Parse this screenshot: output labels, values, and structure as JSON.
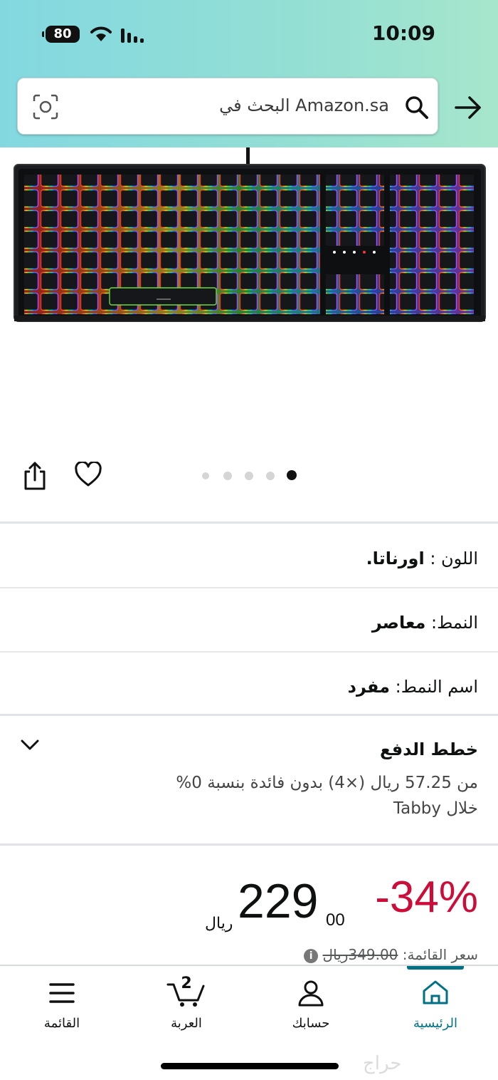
{
  "status_bar": {
    "battery": "80",
    "time": "10:09"
  },
  "search": {
    "placeholder": "البحث في Amazon.sa"
  },
  "gallery": {
    "image_count": 5,
    "active_index": 0
  },
  "attributes": {
    "color": {
      "label": "اللون :",
      "value": "اورناتا."
    },
    "style": {
      "label": "النمط:",
      "value": "معاصر"
    },
    "pattern_name": {
      "label": "اسم النمط:",
      "value": "مفرد"
    }
  },
  "payment_plans": {
    "title": "خطط الدفع",
    "line1": "من 57.25 ريال (×4) بدون فائدة بنسبة 0%",
    "line2": "خلال Tabby"
  },
  "price": {
    "discount": "-34%",
    "whole": "229",
    "fraction": "00",
    "currency": "ريال",
    "list_label": "سعر القائمة:",
    "list_value": "349.00ريال"
  },
  "bottom_nav": {
    "home": "الرئيسية",
    "account": "حسابك",
    "cart": "العربة",
    "cart_count": "2",
    "menu": "القائمة"
  },
  "colors": {
    "header_gradient_start": "#83d8e0",
    "header_gradient_end": "#a6e6cc",
    "discount_red": "#cc0c39",
    "nav_active": "#007185"
  },
  "watermark": "حراج"
}
